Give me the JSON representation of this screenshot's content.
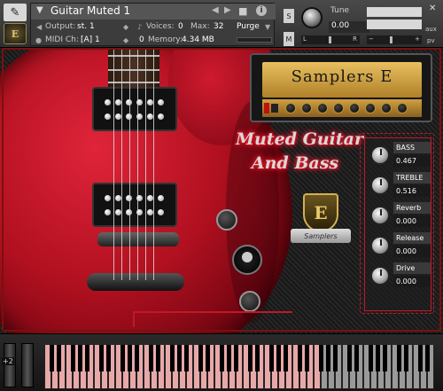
{
  "header": {
    "instrument_name": "Guitar Muted 1",
    "output_label": "Output:",
    "output_value": "st. 1",
    "midi_label": "MIDI Ch:",
    "midi_value": "[A]  1",
    "voices_label": "Voices:",
    "voices_value": "0",
    "max_label": "Max:",
    "max_value": "32",
    "memory_label": "Memory:",
    "memory_value": "4.34 MB",
    "memory_count": "0",
    "purge_label": "Purge",
    "solo_label": "S",
    "mute_label": "M",
    "tune_label": "Tune",
    "tune_value": "0.00",
    "pan_left": "L",
    "pan_right": "R",
    "vol_minus": "−",
    "vol_plus": "+",
    "aux_label": "aux",
    "pv_label": "pv"
  },
  "instrument": {
    "amp_title": "Samplers E",
    "title_line1": "Muted Guitar",
    "title_line2": "And  Bass",
    "badge_letter": "E",
    "badge_ribbon": "Samplers",
    "controls": [
      {
        "label": "BASS",
        "value": "0.467"
      },
      {
        "label": "TREBLE",
        "value": "0.516"
      },
      {
        "label": "Reverb",
        "value": "0.000"
      },
      {
        "label": "Release",
        "value": "0.000"
      },
      {
        "label": "Drive",
        "value": "0.000"
      }
    ]
  },
  "keyboard": {
    "octave_label": "+2",
    "highlight_color": "#e8a8a8"
  },
  "colors": {
    "accent_red": "#c01828",
    "header_bg": "#3c3c3c"
  }
}
